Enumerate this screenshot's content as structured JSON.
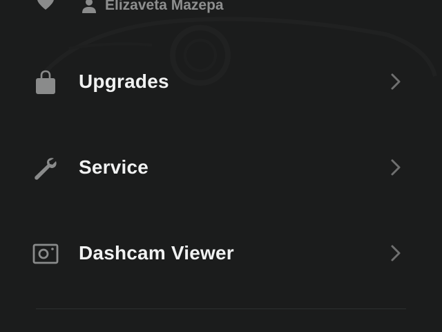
{
  "owner": {
    "name": "Elizaveta Mazepa",
    "location_icon": "map-pin-icon",
    "person_icon": "person-icon"
  },
  "menu": {
    "items": [
      {
        "label": "Upgrades",
        "icon": "shopping-bag-icon"
      },
      {
        "label": "Service",
        "icon": "wrench-icon"
      },
      {
        "label": "Dashcam Viewer",
        "icon": "dashcam-icon"
      }
    ]
  },
  "colors": {
    "background": "#1b1c1c",
    "text": "#f1f2f2",
    "icon": "#8a8b8b",
    "muted_text": "#8e8f8f"
  }
}
